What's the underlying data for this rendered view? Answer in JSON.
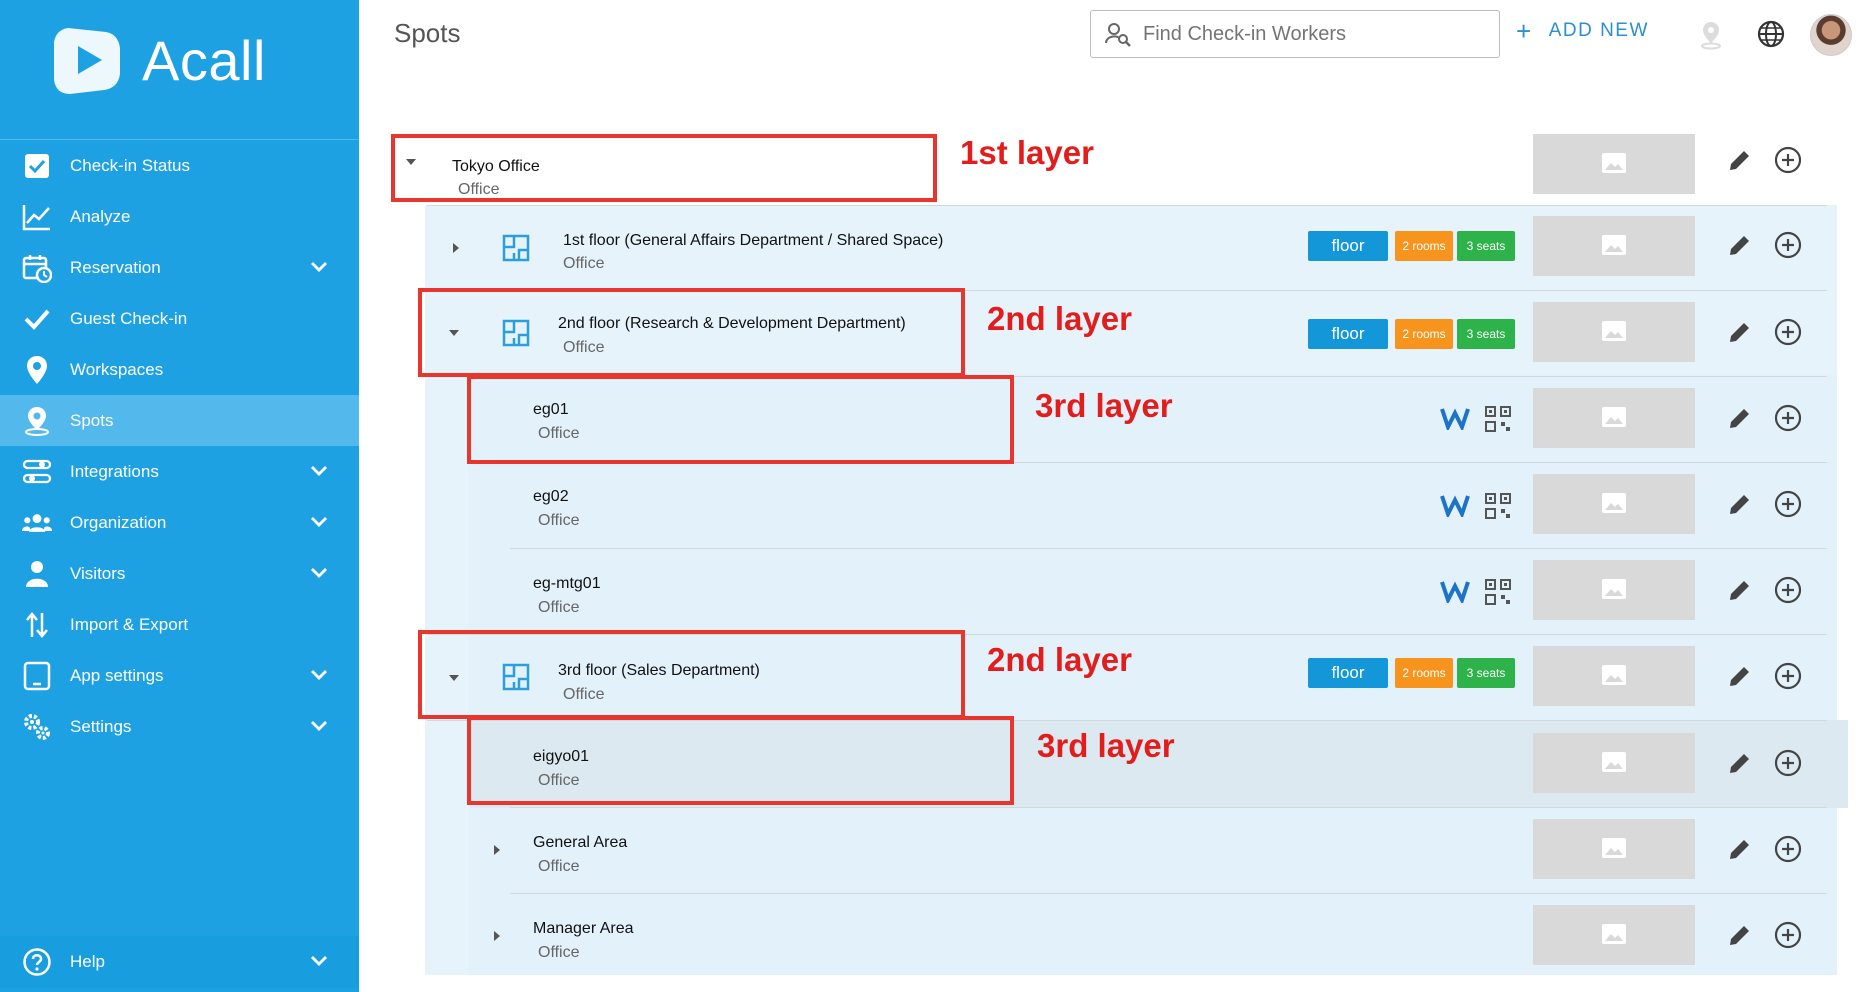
{
  "brand": {
    "name": "Acall"
  },
  "header": {
    "title": "Spots",
    "search_placeholder": "Find Check-in Workers",
    "add_new_label": "ADD NEW"
  },
  "colors": {
    "sidebar": "#1ea1e3",
    "active": "#53b8ec",
    "floor_badge": "#1497d8",
    "rooms_badge": "#f7941d",
    "seats_badge": "#2db34a",
    "annotation": "#e8362f"
  },
  "sidebar": {
    "items": [
      {
        "label": "Check-in Status",
        "icon": "check-square-icon",
        "chevron": false
      },
      {
        "label": "Analyze",
        "icon": "chart-line-icon",
        "chevron": false
      },
      {
        "label": "Reservation",
        "icon": "calendar-clock-icon",
        "chevron": true
      },
      {
        "label": "Guest Check-in",
        "icon": "checkmark-icon",
        "chevron": false
      },
      {
        "label": "Workspaces",
        "icon": "map-pin-icon",
        "chevron": false
      },
      {
        "label": "Spots",
        "icon": "spot-pin-icon",
        "chevron": false,
        "active": true
      },
      {
        "label": "Integrations",
        "icon": "integrations-icon",
        "chevron": true
      },
      {
        "label": "Organization",
        "icon": "group-icon",
        "chevron": true
      },
      {
        "label": "Visitors",
        "icon": "visitor-icon",
        "chevron": true
      },
      {
        "label": "Import & Export",
        "icon": "import-export-icon",
        "chevron": false
      },
      {
        "label": "App settings",
        "icon": "tablet-icon",
        "chevron": true
      },
      {
        "label": "Settings",
        "icon": "gears-icon",
        "chevron": true
      }
    ],
    "help_label": "Help"
  },
  "spots": [
    {
      "name": "Tokyo Office",
      "type": "Office",
      "level": 1
    },
    {
      "name": "1st floor (General Affairs Department / Shared Space)",
      "type": "Office",
      "level": 2,
      "floor": "floor",
      "rooms": "2 rooms",
      "seats": "3 seats"
    },
    {
      "name": "2nd floor (Research & Development Department)",
      "type": "Office",
      "level": 2,
      "floor": "floor",
      "rooms": "2 rooms",
      "seats": "3 seats"
    },
    {
      "name": "eg01",
      "type": "Office",
      "level": 3
    },
    {
      "name": "eg02",
      "type": "Office",
      "level": 3
    },
    {
      "name": "eg-mtg01",
      "type": "Office",
      "level": 3
    },
    {
      "name": "3rd floor (Sales Department)",
      "type": "Office",
      "level": 2,
      "floor": "floor",
      "rooms": "2 rooms",
      "seats": "3 seats"
    },
    {
      "name": "eigyo01",
      "type": "Office",
      "level": 3
    },
    {
      "name": "General Area",
      "type": "Office",
      "level": 3
    },
    {
      "name": "Manager Area",
      "type": "Office",
      "level": 3
    }
  ],
  "annotations": [
    "1st layer",
    "2nd layer",
    "3rd layer",
    "2nd layer",
    "3rd layer"
  ]
}
